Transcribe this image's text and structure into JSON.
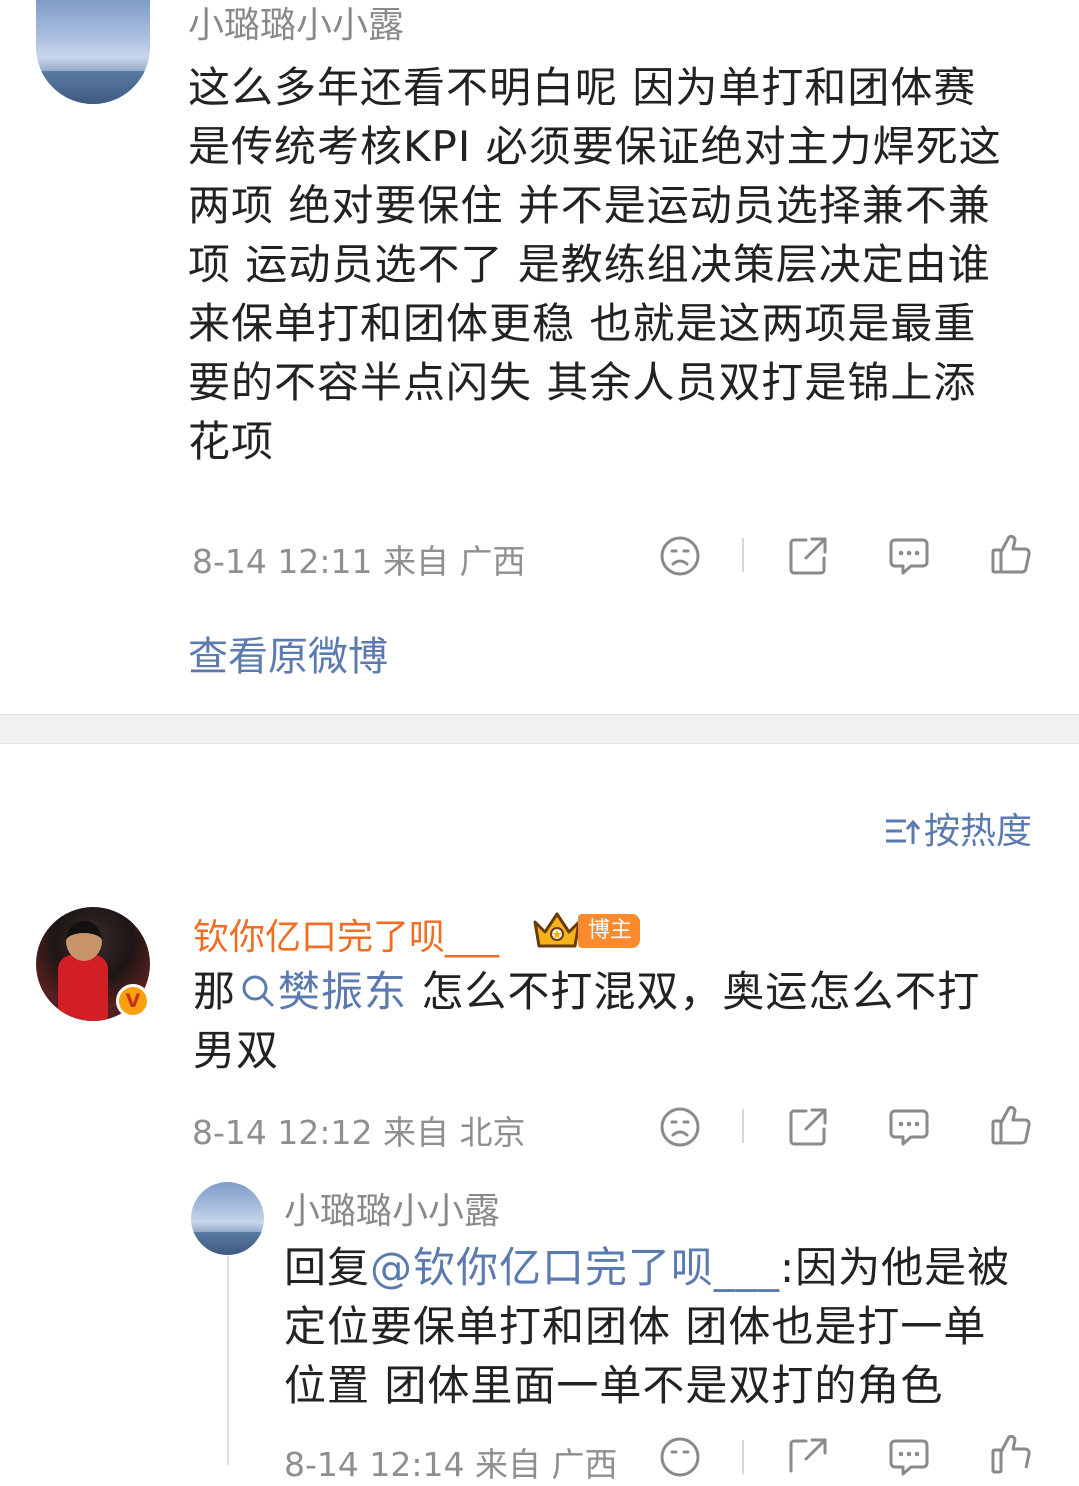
{
  "top_post": {
    "author": "小璐璐小小露",
    "lines": [
      "这么多年还看不明白呢  因为单打和团体赛",
      "是传统考核KPI  必须要保证绝对主力焊死这",
      "两项  绝对要保住  并不是运动员选择兼不兼",
      "项  运动员选不了  是教练组决策层决定由谁",
      "来保单打和团体更稳  也就是这两项是最重",
      "要的不容半点闪失   其余人员双打是锦上添",
      "花项"
    ],
    "meta": "8-14 12:11  来自 广西",
    "view_original": "查看原微博"
  },
  "sort_label": "按热度",
  "comment": {
    "author": "钦你亿口完了呗___",
    "author_badge": "博主",
    "verified_badge": "V",
    "text_prefix": "那",
    "mention": "樊振东",
    "text_line1_rest": " 怎么不打混双，奥运怎么不打",
    "text_line2": "男双",
    "meta": "8-14 12:12  来自 北京"
  },
  "reply": {
    "author": "小璐璐小小露",
    "prefix": "回复",
    "mention": "@钦你亿口完了呗___",
    "line1_rest": ":因为他是被",
    "line2": "定位要保单打和团体  团体也是打一单",
    "line3": "位置  团体里面一单不是双打的角色",
    "meta": "8-14 12:14  来自 广西"
  },
  "icons": {
    "dislike": "sad-face-icon",
    "share": "share-icon",
    "comment": "comment-icon",
    "like": "thumbs-up-icon",
    "sort": "sort-icon",
    "search": "search-icon",
    "crown": "crown-icon"
  },
  "colors": {
    "link": "#5b7bb0",
    "orange_name": "#f26d24",
    "badge": "#f98a2d",
    "gray_text": "#8f8f8f"
  }
}
